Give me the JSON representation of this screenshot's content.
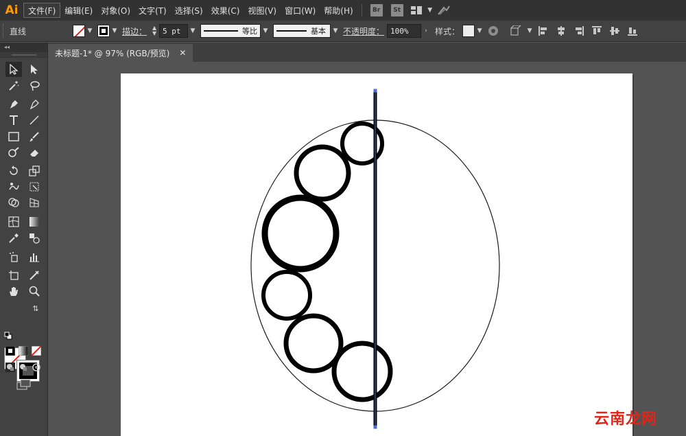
{
  "app": {
    "logo": "Ai"
  },
  "menubar": {
    "items": [
      "文件(F)",
      "编辑(E)",
      "对象(O)",
      "文字(T)",
      "选择(S)",
      "效果(C)",
      "视图(V)",
      "窗口(W)",
      "帮助(H)"
    ],
    "bridge": "Br",
    "stock": "St"
  },
  "controlbar": {
    "object_type": "直线",
    "stroke_label": "描边：",
    "stroke_weight": "5 pt",
    "profile_label": "等比",
    "brush_label": "基本",
    "opacity_label": "不透明度：",
    "opacity_value": "100%",
    "style_label": "样式："
  },
  "tab": {
    "title": "未标题-1* @ 97% (RGB/预览)",
    "close": "✕"
  },
  "toolbox": {
    "collapse": "◂◂"
  },
  "watermark": "云南龙网",
  "colors": {
    "accent": "#ff9a00",
    "selection": "#4a6fd6",
    "watermark": "#e0251a"
  }
}
